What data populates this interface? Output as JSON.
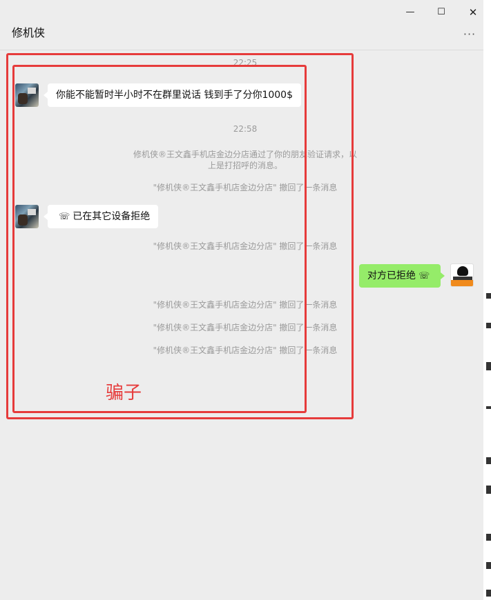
{
  "window": {
    "title": "修机侠",
    "controls": {
      "minimize": "—",
      "maximize": "☐",
      "close": "✕"
    },
    "more": "···"
  },
  "messages": [
    {
      "type": "time",
      "text": "22:25"
    },
    {
      "type": "incoming",
      "text": "你能不能暂时半小时不在群里说话   钱到手了分你1000$"
    },
    {
      "type": "time",
      "text": "22:58"
    },
    {
      "type": "system",
      "line1": "修机侠®王文鑫手机店金边分店通过了你的朋友验证请求，以",
      "line2": "上是打招呼的消息。"
    },
    {
      "type": "system",
      "text": "\"修机侠®王文鑫手机店金边分店\" 撤回了一条消息"
    },
    {
      "type": "incoming_call",
      "icon": "phone-hangup-icon",
      "text": "已在其它设备拒绝"
    },
    {
      "type": "system",
      "text": "\"修机侠®王文鑫手机店金边分店\" 撤回了一条消息"
    },
    {
      "type": "outgoing_call",
      "icon": "phone-hangup-icon",
      "text": "对方已拒绝"
    },
    {
      "type": "system",
      "text": "\"修机侠®王文鑫手机店金边分店\" 撤回了一条消息"
    },
    {
      "type": "system",
      "text": "\"修机侠®王文鑫手机店金边分店\" 撤回了一条消息"
    },
    {
      "type": "system",
      "text": "\"修机侠®王文鑫手机店金边分店\" 撤回了一条消息"
    }
  ],
  "annotation": {
    "text": "骗子",
    "color": "#e63b3b"
  },
  "colors": {
    "accent": "#1f6fd8",
    "self_bubble": "#95ec69",
    "incoming_bubble": "#ffffff",
    "system_text": "#9a9a9a"
  }
}
